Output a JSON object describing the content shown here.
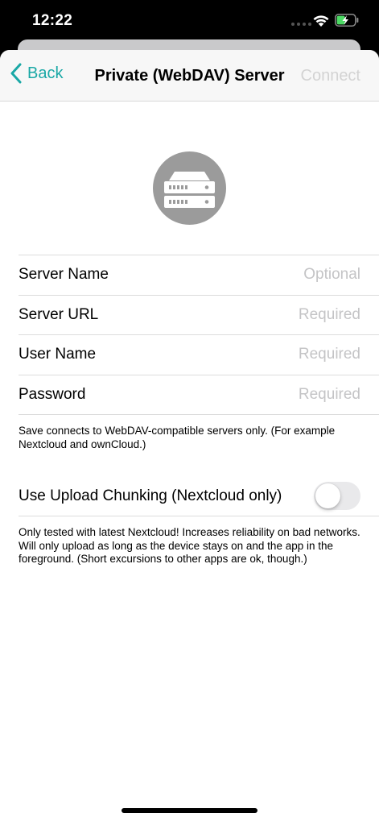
{
  "status_bar": {
    "time": "12:22"
  },
  "nav": {
    "back_label": "Back",
    "title": "Private (WebDAV) Server",
    "connect_label": "Connect"
  },
  "icons": {
    "server": "server-icon"
  },
  "form": {
    "fields": [
      {
        "label": "Server Name",
        "placeholder": "Optional",
        "value": ""
      },
      {
        "label": "Server URL",
        "placeholder": "Required",
        "value": ""
      },
      {
        "label": "User Name",
        "placeholder": "Required",
        "value": ""
      },
      {
        "label": "Password",
        "placeholder": "Required",
        "value": ""
      }
    ],
    "footnote": "Save connects to WebDAV-compatible servers only. (For example Nextcloud and ownCloud.)"
  },
  "chunking": {
    "label": "Use Upload Chunking (Nextcloud only)",
    "enabled": false,
    "footnote": "Only tested with latest Nextcloud! Increases reliability on bad networks. Will only upload as long as the device stays on and the app in the foreground. (Short excursions to other apps are ok, though.)"
  },
  "colors": {
    "accent": "#1aa8a6",
    "disabled": "#d3d3d3",
    "icon_gray": "#9b9b9b"
  }
}
